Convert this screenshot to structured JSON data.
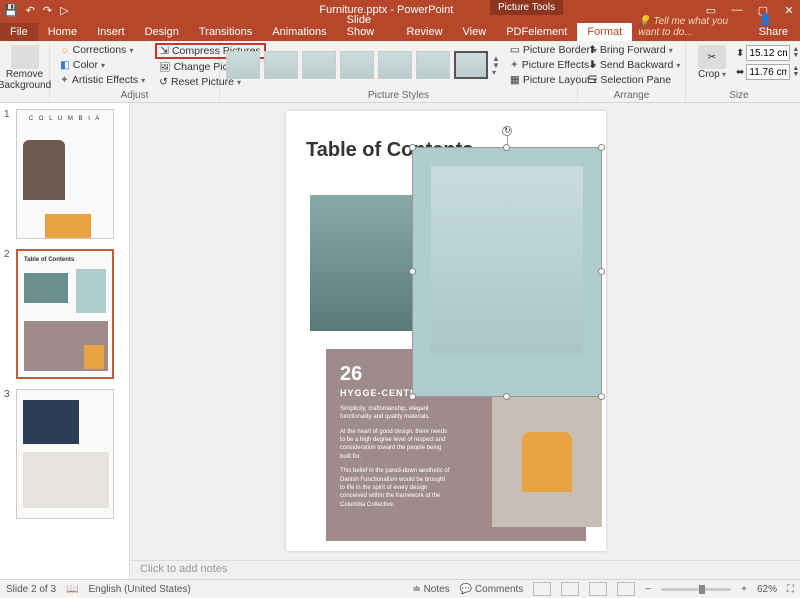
{
  "title": "Furniture.pptx - PowerPoint",
  "contextual_tab": "Picture Tools",
  "quick_access": {
    "save": "💾",
    "undo": "↶",
    "redo": "↷",
    "start": "▷"
  },
  "window_controls": {
    "min": "—",
    "max": "▢",
    "close": "✕",
    "ribbon_toggle": "▭"
  },
  "tabs": [
    "File",
    "Home",
    "Insert",
    "Design",
    "Transitions",
    "Animations",
    "Slide Show",
    "Review",
    "View",
    "PDFelement",
    "Format"
  ],
  "tell_me": "Tell me what you want to do...",
  "share": "Share",
  "ribbon": {
    "adjust": {
      "label": "Adjust",
      "remove_bg": "Remove Background",
      "corrections": "Corrections",
      "color": "Color",
      "artistic": "Artistic Effects",
      "compress": "Compress Pictures",
      "change": "Change Picture",
      "reset": "Reset Picture"
    },
    "styles": {
      "label": "Picture Styles",
      "border": "Picture Border",
      "effects": "Picture Effects",
      "layout": "Picture Layout"
    },
    "arrange": {
      "label": "Arrange",
      "forward": "Bring Forward",
      "backward": "Send Backward",
      "selpane": "Selection Pane"
    },
    "size": {
      "label": "Size",
      "crop": "Crop",
      "height": "15.12 cm",
      "width": "11.76 cm"
    }
  },
  "slide": {
    "toc": "Table of Contents",
    "num": "26",
    "heading": "HYGGE-CENTRIC DESIGN VALUES",
    "p1": "Simplicity, craftsmanship, elegant functionality and quality materials.",
    "p2": "At the heart of good design, there needs to be a high degree level of respect and consideration toward the people being built for.",
    "p3": "This belief in the pared-down aesthetic of Danish Functionalism would be brought to life in the spirit of every design conceived within the framework of the Columbia Collective."
  },
  "thumbs": [
    "1",
    "2",
    "3"
  ],
  "thumb1_brand": "C O L U M B I A",
  "notes_placeholder": "Click to add notes",
  "status": {
    "slide": "Slide 2 of 3",
    "lang": "English (United States)",
    "notes": "Notes",
    "comments": "Comments",
    "zoom": "62%"
  }
}
